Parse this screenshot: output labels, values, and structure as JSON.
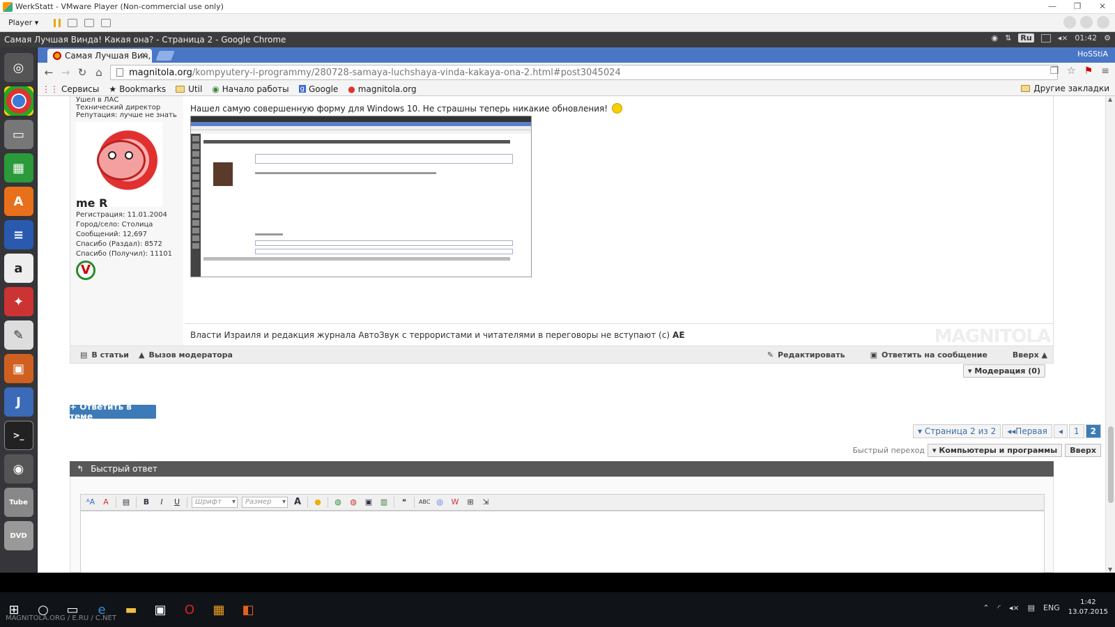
{
  "vm": {
    "title": "WerkStatt - VMware Player (Non-commercial use only)",
    "player_label": "Player ▾"
  },
  "guest": {
    "window_title": "Самая Лучшая Винда! Какая она? - Страница 2 - Google Chrome",
    "lang": "Ru",
    "time": "01:42"
  },
  "browser": {
    "tab_title": "Самая Лучшая Вин,",
    "tab_close": "×",
    "profile": "HoSStiA",
    "url_host": "magnitola.org",
    "url_path": "/kompyutery-i-programmy/280728-samaya-luchshaya-vinda-kakaya-ona-2.html#post3045024",
    "bookmarks": [
      {
        "icon": "apps-icon",
        "label": "Сервисы"
      },
      {
        "icon": "star-icon",
        "label": "Bookmarks"
      },
      {
        "icon": "folder-icon",
        "label": "Util"
      },
      {
        "icon": "chrome-icon",
        "label": "Начало работы"
      },
      {
        "icon": "google-icon",
        "label": "Google"
      },
      {
        "icon": "magnitola-icon",
        "label": "magnitola.org"
      }
    ],
    "other_bookmarks": "Другие закладки"
  },
  "user": {
    "status": "Ушел в ЛАС",
    "role": "Технический директор",
    "reputation": "Репутация: лучше не знать",
    "avatar_caption": "me R",
    "registration": "Регистрация:   11.01.2004",
    "city": "Город/село:   Столица",
    "messages": "Сообщений:   12,697",
    "thanks_given": "Спасибо (Раздал):   8572",
    "thanks_received": "Спасибо (Получил):   11101",
    "award_letter": "V"
  },
  "post": {
    "text": "Нашел самую совершенную форму для Windows 10. Не страшны теперь никакие обновления!",
    "signature": "Власти Израиля и редакция журнала АвтоЗвук с террористами и читателями в переговоры не вступают (c)",
    "signature_author": "AE",
    "watermark": "MAGNITOLA"
  },
  "postfoot": {
    "to_articles": "В статьи",
    "call_moderator": "Вызов модератора",
    "edit": "Редактировать",
    "reply_to_message": "Ответить на сообщение",
    "top": "Вверх ▲"
  },
  "moderation": "▾ Модерация (0)",
  "reply_in_thread": "+ Ответить в теме",
  "pager": {
    "label": "▾ Страница 2 из 2",
    "first": "◂◂Первая",
    "prev": "◂",
    "pages": [
      "1",
      "2"
    ]
  },
  "jump": {
    "label": "Быстрый переход",
    "forum": "▾ Компьютеры и программы",
    "top": "Вверх"
  },
  "quick_reply": {
    "title": "Быстрый ответ",
    "font_placeholder": "Шрифт",
    "size_placeholder": "Размер",
    "bold": "B",
    "italic": "I",
    "underline": "U",
    "font_color": "A"
  },
  "host": {
    "watermark": "MAGNITOLA.ORG / E.RU / C.NET",
    "lang": "ENG",
    "time": "1:42",
    "date": "13.07.2015"
  }
}
